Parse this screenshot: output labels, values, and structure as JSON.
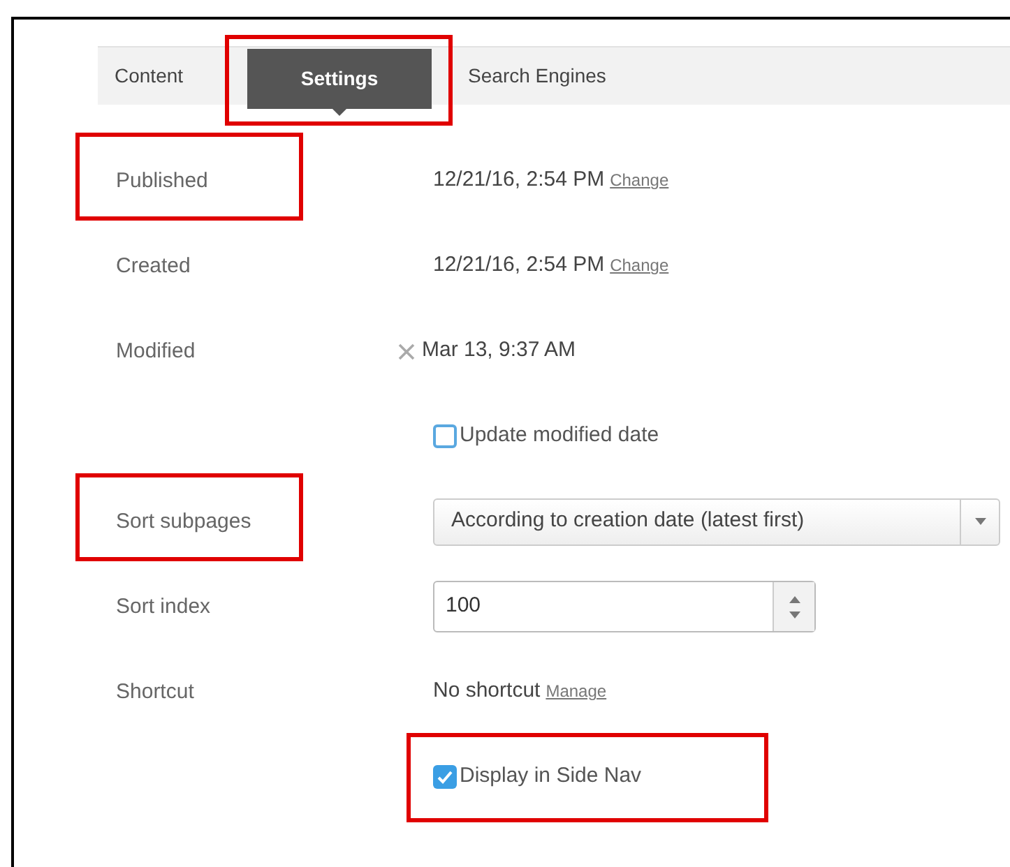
{
  "tabs": [
    {
      "label": "Content",
      "selected": false,
      "highlighted": false
    },
    {
      "label": "Settings",
      "selected": true,
      "highlighted": true
    },
    {
      "label": "Search Engines",
      "selected": false,
      "highlighted": false
    }
  ],
  "rows": [
    {
      "kind": "datetime",
      "label": "Published",
      "value": "12/21/16, 2:54 PM",
      "link": "Change",
      "highlighted": true
    },
    {
      "kind": "datetime",
      "label": "Created",
      "value": "12/21/16, 2:54 PM",
      "link": "Change",
      "highlighted": false
    },
    {
      "kind": "clearable",
      "label": "Modified",
      "value": "Mar 13, 9:37 AM",
      "highlighted": false
    },
    {
      "kind": "checkbox",
      "text": "Update modified date",
      "checked": false,
      "highlighted": false
    },
    {
      "kind": "select",
      "label": "Sort subpages",
      "value": "According to creation date (latest first)",
      "highlighted": true
    },
    {
      "kind": "number",
      "label": "Sort index",
      "value": "100",
      "highlighted": false
    },
    {
      "kind": "datetime",
      "label": "Shortcut",
      "value": "No shortcut",
      "link": "Manage",
      "highlighted": false
    },
    {
      "kind": "checkbox",
      "text": "Display in Side Nav",
      "checked": true,
      "highlighted": true
    }
  ]
}
